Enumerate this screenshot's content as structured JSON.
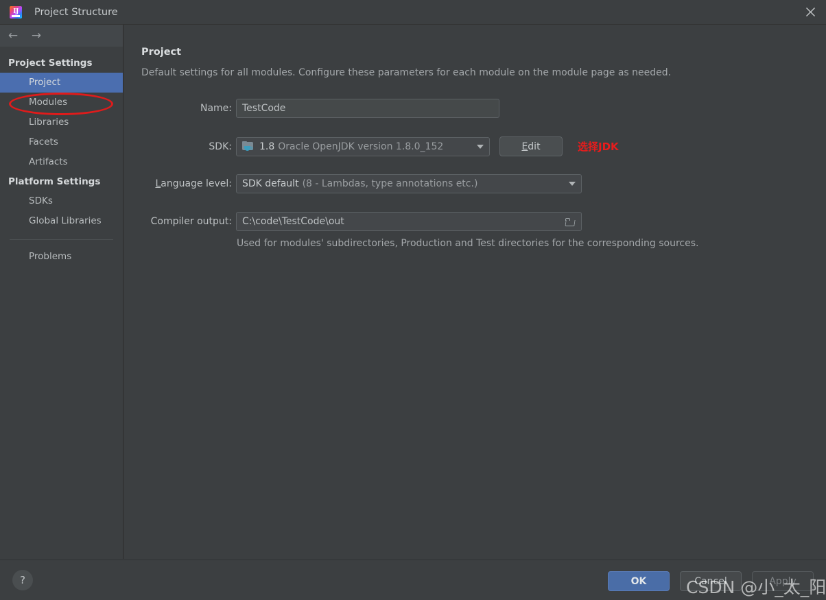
{
  "window": {
    "title": "Project Structure",
    "logo_icon": "intellij-idea-logo",
    "logo_glyph": "IJ",
    "close_icon": "close-icon"
  },
  "sidebar": {
    "nav": {
      "back_icon": "arrow-left-icon",
      "back_glyph": "←",
      "forward_icon": "arrow-right-icon",
      "forward_glyph": "→"
    },
    "groups": [
      {
        "label": "Project Settings",
        "items": [
          {
            "label": "Project",
            "selected": true
          },
          {
            "label": "Modules",
            "selected": false
          },
          {
            "label": "Libraries",
            "selected": false
          },
          {
            "label": "Facets",
            "selected": false
          },
          {
            "label": "Artifacts",
            "selected": false
          }
        ]
      },
      {
        "label": "Platform Settings",
        "items": [
          {
            "label": "SDKs",
            "selected": false
          },
          {
            "label": "Global Libraries",
            "selected": false
          }
        ]
      }
    ],
    "footer_items": [
      {
        "label": "Problems",
        "selected": false
      }
    ]
  },
  "main": {
    "title": "Project",
    "description": "Default settings for all modules. Configure these parameters for each module on the module page as needed.",
    "fields": {
      "name": {
        "label": "Name:",
        "value": "TestCode"
      },
      "sdk": {
        "label": "SDK:",
        "icon": "java-sdk-folder-icon",
        "version": "1.8",
        "detail": "Oracle OpenJDK version 1.8.0_152",
        "edit_label_prefix": "",
        "edit_label_mnemonic": "E",
        "edit_label_rest": "dit"
      },
      "language_level": {
        "label_mnemonic": "L",
        "label_rest": "anguage level:",
        "value_main": "SDK default",
        "value_detail": "(8 - Lambdas, type annotations etc.)"
      },
      "compiler_output": {
        "label": "Compiler output:",
        "value": "C:\\code\\TestCode\\out",
        "browse_icon": "browse-folder-icon",
        "hint": "Used for modules' subdirectories, Production and Test directories for the corresponding sources."
      }
    }
  },
  "annotations": {
    "sdk_note": "选择JDK",
    "project_highlight_icon": "red-ellipse-annotation"
  },
  "footer": {
    "help_icon": "help-question-icon",
    "help_glyph": "?",
    "ok_label": "OK",
    "cancel_label": "Cancel",
    "apply_label": "Apply"
  },
  "watermark": {
    "text": "CSDN @小_太_阳"
  },
  "colors": {
    "background": "#3c3f41",
    "selection": "#4b6eaf",
    "accent_button": "#4a6da7",
    "annotation_red": "#e81c1c",
    "java_icon": "#3b9dbd"
  }
}
